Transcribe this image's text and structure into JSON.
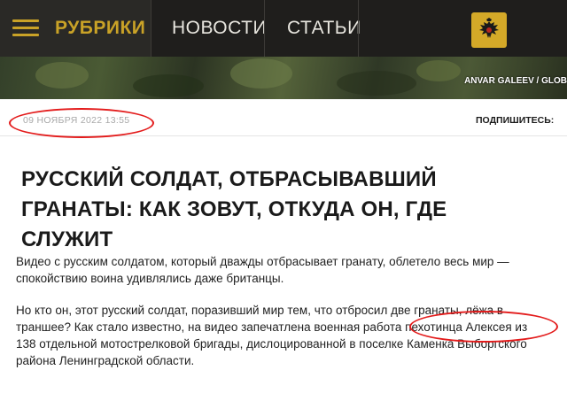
{
  "header": {
    "menu_label": "РУБРИКИ",
    "nav": [
      "НОВОСТИ",
      "СТАТЬИ"
    ],
    "emblem_icon": "double-headed-eagle-icon"
  },
  "hero": {
    "credit": "ANVAR GALEEV / GLOB"
  },
  "meta": {
    "date": "09 НОЯБРЯ 2022 13:55",
    "subscribe_label": "ПОДПИШИТЕСЬ:"
  },
  "article": {
    "title": "РУССКИЙ СОЛДАТ, ОТБРАСЫВАВШИЙ ГРАНАТЫ: КАК ЗОВУТ, ОТКУДА ОН, ГДЕ СЛУЖИТ",
    "paragraphs": [
      "Видео с русским солдатом, который дважды отбрасывает гранату, облетело весь мир — спокойствию воина удивлялись даже британцы.",
      "Но кто он, этот русский солдат, поразивший мир тем, что отбросил две гранаты, лёжа в траншее? Как стало известно, на видео запечатлена военная работа пехотинца Алексея из 138 отдельной мотострелковой бригады, дислоцированной в поселке Каменка Выборгского района Ленинградской области."
    ]
  },
  "colors": {
    "header_bg": "#1f1e1c",
    "accent_gold": "#c9a227",
    "annotation_red": "#e31b1b"
  }
}
